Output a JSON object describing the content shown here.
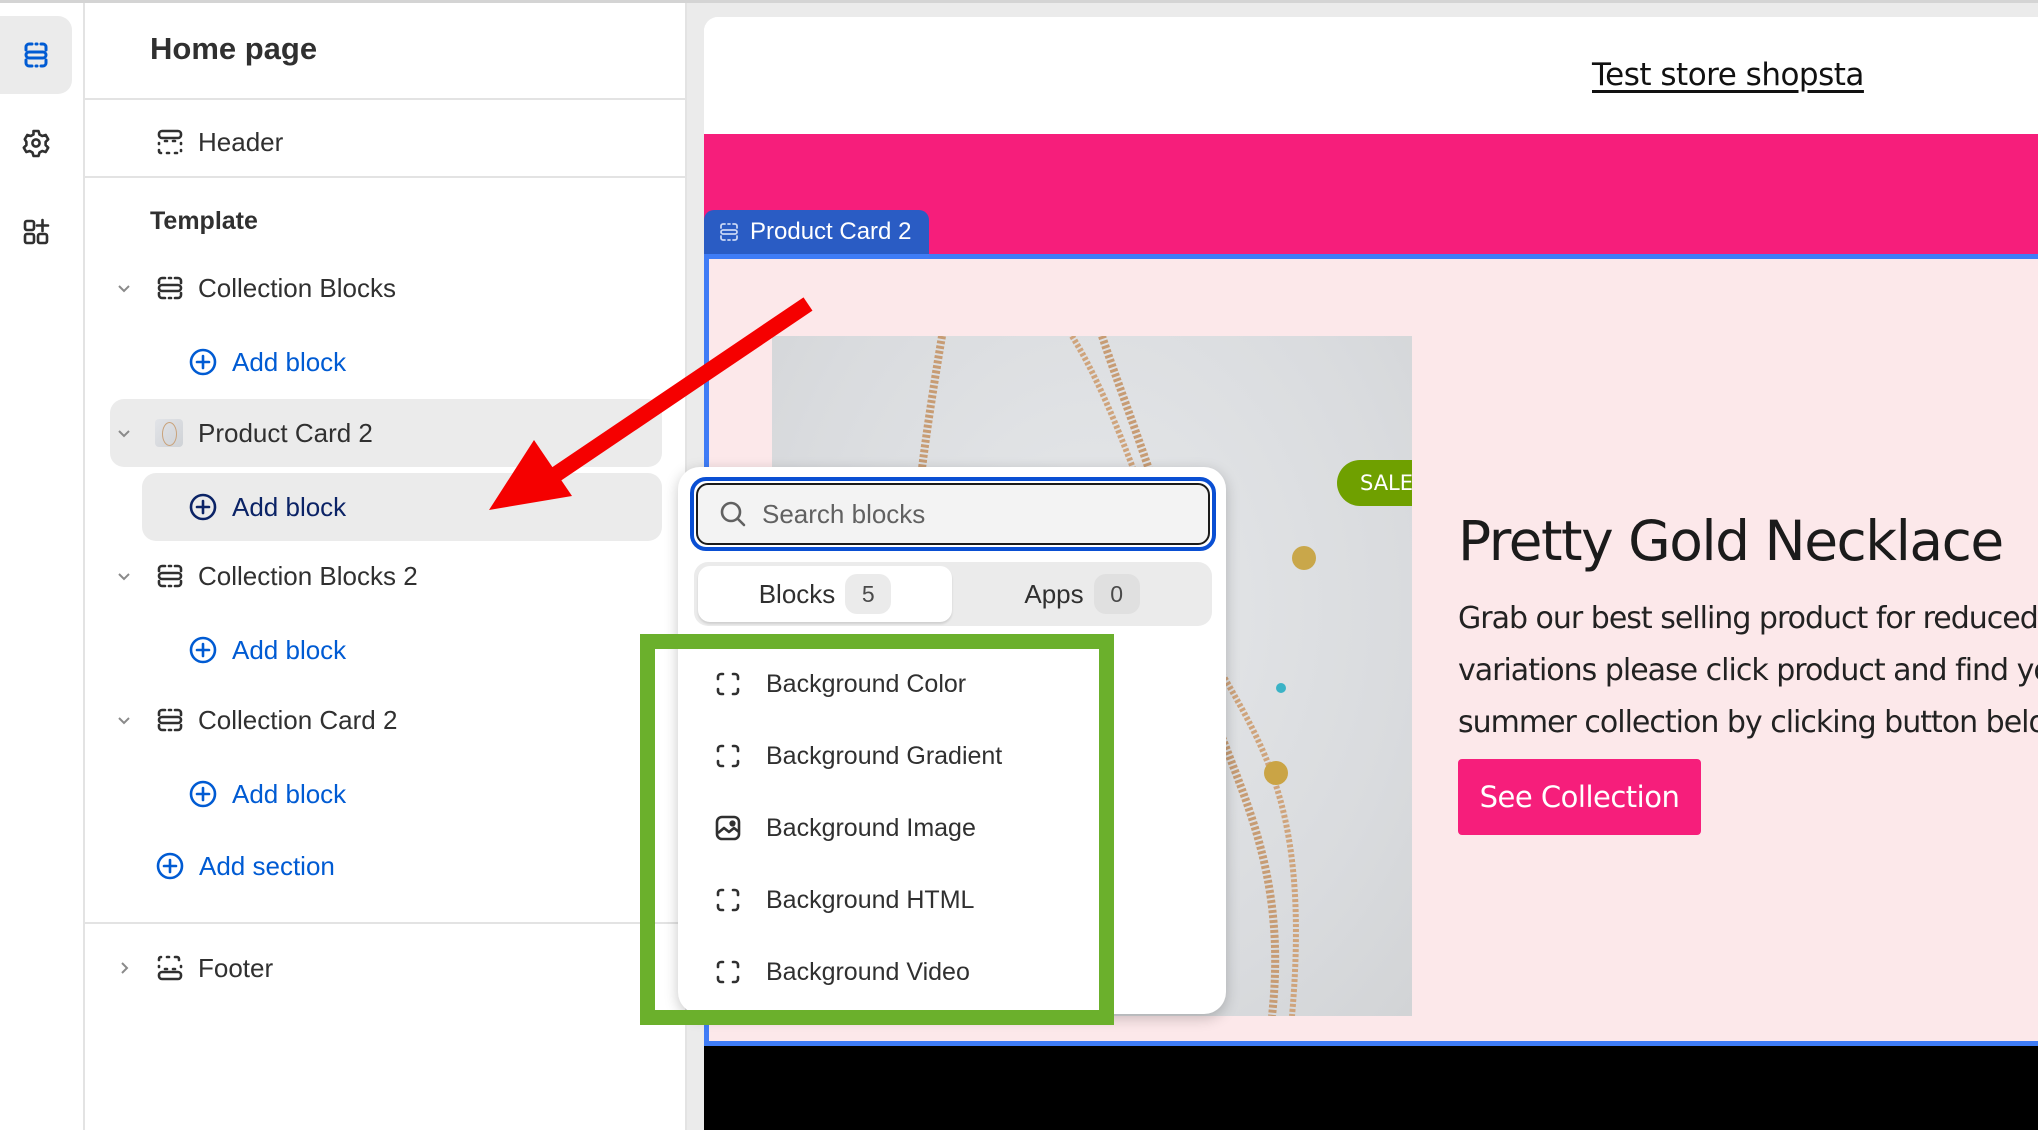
{
  "rail": {
    "items": [
      {
        "name": "sections",
        "icon": "sections-icon",
        "active": true
      },
      {
        "name": "theme-settings",
        "icon": "gear-icon",
        "active": false
      },
      {
        "name": "apps",
        "icon": "apps-icon",
        "active": false
      }
    ]
  },
  "sidebar": {
    "title": "Home page",
    "header_label": "Header",
    "template_label": "Template",
    "sections": [
      {
        "label": "Collection Blocks",
        "icon": "section-icon",
        "add_block": "Add block"
      },
      {
        "label": "Product Card 2",
        "icon": "product-thumbnail",
        "add_block": "Add block",
        "selected": true
      },
      {
        "label": "Collection Blocks 2",
        "icon": "section-icon",
        "add_block": "Add block"
      },
      {
        "label": "Collection Card 2",
        "icon": "section-icon",
        "add_block": "Add block"
      }
    ],
    "add_section": "Add section",
    "footer_label": "Footer"
  },
  "preview": {
    "store_name": "Test store shopsta",
    "section_tag": "Product Card 2",
    "sale_badge": "SALE",
    "product_title": "Pretty Gold Necklace",
    "description_lines": [
      "Grab our best selling product for reduced pr",
      "variations please click product and find your",
      "summer collection by clicking button below"
    ],
    "cta_label": "See Collection",
    "colors": {
      "brand_pink": "#f61e7b",
      "section_bg": "#fce8ea",
      "selection_blue": "#3f7cf6",
      "sale_green": "#6fa000"
    }
  },
  "popover": {
    "search_placeholder": "Search blocks",
    "search_value": "",
    "tabs": [
      {
        "label": "Blocks",
        "count": "5",
        "active": true
      },
      {
        "label": "Apps",
        "count": "0",
        "active": false
      }
    ],
    "items": [
      {
        "label": "Background Color",
        "icon": "dashed-square-icon"
      },
      {
        "label": "Background Gradient",
        "icon": "dashed-square-icon"
      },
      {
        "label": "Background Image",
        "icon": "image-icon"
      },
      {
        "label": "Background HTML",
        "icon": "dashed-square-icon"
      },
      {
        "label": "Background Video",
        "icon": "dashed-square-icon"
      }
    ]
  },
  "annotations": {
    "arrow_color": "#f50000",
    "highlight_box_color": "#6bb02c"
  }
}
